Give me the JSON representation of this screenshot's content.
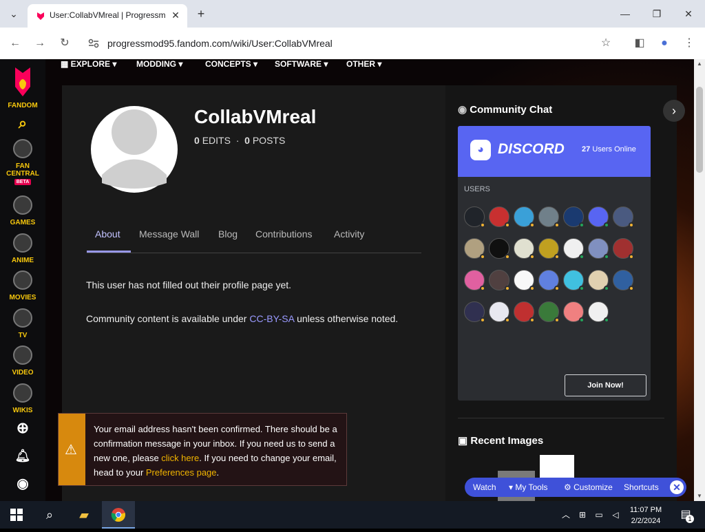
{
  "browser": {
    "tab_title": "User:CollabVMreal | Progressm",
    "url": "progressmod95.fandom.com/wiki/User:CollabVMreal",
    "new_tab": "+",
    "minimize": "—",
    "maximize": "❐",
    "close": "✕",
    "back": "←",
    "forward": "→",
    "reload": "↻"
  },
  "rail": {
    "items": [
      {
        "label": "FANDOM"
      },
      {
        "label": "FAN CENTRAL"
      },
      {
        "label": "GAMES"
      },
      {
        "label": "ANIME"
      },
      {
        "label": "MOVIES"
      },
      {
        "label": "TV"
      },
      {
        "label": "VIDEO"
      },
      {
        "label": "WIKIS"
      }
    ],
    "beta": "BETA"
  },
  "topnav": {
    "items": [
      "EXPLORE",
      "MODDING",
      "CONCEPTS",
      "SOFTWARE",
      "OTHER"
    ]
  },
  "profile": {
    "username": "CollabVMreal",
    "edits_count": "0",
    "edits_label": "EDITS",
    "separator": "·",
    "posts_count": "0",
    "posts_label": "POSTS"
  },
  "tabs": [
    "About",
    "Message Wall",
    "Blog",
    "Contributions",
    "Activity"
  ],
  "about": {
    "empty": "This user has not filled out their profile page yet.",
    "license_prefix": "Community content is available under ",
    "license_link": "CC-BY-SA",
    "license_suffix": " unless otherwise noted."
  },
  "notice": {
    "icon": "⚠",
    "text_1": "Your email address hasn't been confirmed. There should be a confirmation message in your inbox. If you need us to send a new one, please ",
    "link_1": "click here",
    "text_2": ". If you need to change your email, head to your ",
    "link_2": "Preferences page",
    "text_3": "."
  },
  "sidebar": {
    "chat_title": "Community Chat",
    "discord_brand": "DISCORD",
    "online_count": "27",
    "online_label": "Users Online",
    "users_label": "USERS",
    "join": "Join Now!",
    "recent_images": "Recent Images"
  },
  "action_bar": {
    "watch": "Watch",
    "my_tools": "My Tools",
    "customize": "Customize",
    "shortcuts": "Shortcuts"
  },
  "taskbar": {
    "time": "11:07 PM",
    "date": "2/2/2024",
    "notifications": "1"
  },
  "colors": {
    "discord": "#5865f2",
    "fandom_yellow": "#f8c80d",
    "fandom_pink": "#fa005a",
    "notice_orange": "#d7890e",
    "tab_active": "#9898e8",
    "actionbar": "#3f51d9"
  }
}
